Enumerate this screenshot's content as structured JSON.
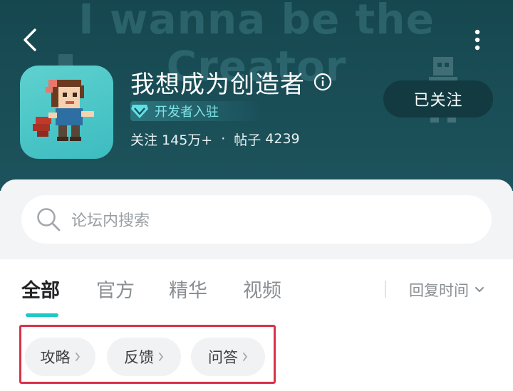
{
  "header": {
    "bg_wordmark_line1": "I wanna be the",
    "bg_wordmark_line2": "Creator",
    "title": "我想成为创造者",
    "dev_badge": "开发者入驻",
    "stats": {
      "follow_label": "关注",
      "follow_count": "145万+",
      "posts_label": "帖子",
      "posts_count": "4239"
    },
    "follow_button": "已关注",
    "icons": {
      "back": "back-arrow-icon",
      "more": "more-vertical-icon",
      "info": "info-icon",
      "badge": "diamond-icon"
    }
  },
  "search": {
    "placeholder": "论坛内搜索",
    "icon": "search-icon"
  },
  "tabs": [
    {
      "label": "全部",
      "active": true
    },
    {
      "label": "官方",
      "active": false
    },
    {
      "label": "精华",
      "active": false
    },
    {
      "label": "视频",
      "active": false
    }
  ],
  "sort": {
    "label": "回复时间",
    "icon": "chevron-down-icon"
  },
  "chips": [
    {
      "label": "攻略"
    },
    {
      "label": "反馈"
    },
    {
      "label": "问答"
    }
  ],
  "colors": {
    "header_bg": "#1a4e57",
    "accent": "#1ec8c6",
    "highlight_frame": "#d9324a",
    "follow_btn_bg": "#123a40"
  }
}
